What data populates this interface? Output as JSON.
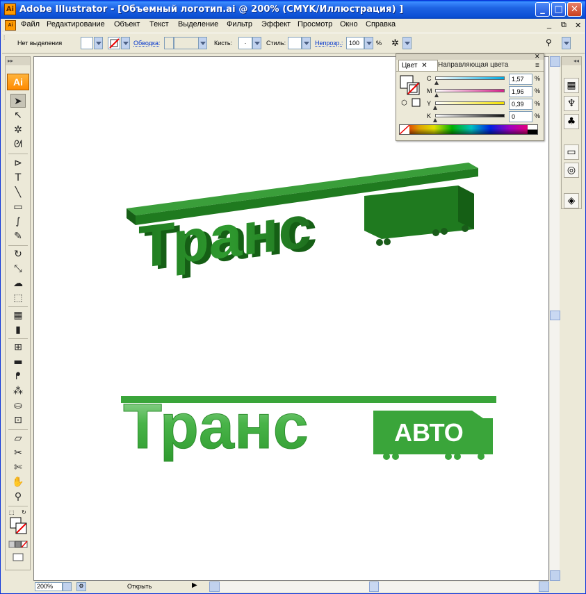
{
  "window": {
    "title": "Adobe Illustrator - [Объемный логотип.ai @ 200% (CMYK/Иллюстрация) ]",
    "app_icon_text": "Ai",
    "minimize": "_",
    "maximize": "□",
    "close": "✕"
  },
  "menu": {
    "items": [
      "Файл",
      "Редактирование",
      "Объект",
      "Текст",
      "Выделение",
      "Фильтр",
      "Эффект",
      "Просмотр",
      "Окно",
      "Справка"
    ],
    "doc_controls": [
      "_",
      "⧉",
      "✕"
    ]
  },
  "control_bar": {
    "selection_label": "Нет выделения",
    "stroke_label": "Обводка:",
    "brush_label": "Кисть:",
    "brush_value": "·",
    "style_label": "Стиль:",
    "opacity_label": "Непрозр.:",
    "opacity_value": "100",
    "opacity_unit": "%"
  },
  "toolbox": {
    "logo": "Ai",
    "tools": [
      {
        "name": "selection-tool",
        "glyph": "➤"
      },
      {
        "name": "direct-selection-tool",
        "glyph": "↖"
      },
      {
        "name": "magic-wand-tool",
        "glyph": "✲"
      },
      {
        "name": "lasso-tool",
        "glyph": "ᘛ"
      },
      {
        "name": "pen-tool",
        "glyph": "⊳"
      },
      {
        "name": "type-tool",
        "glyph": "T"
      },
      {
        "name": "line-tool",
        "glyph": "╲"
      },
      {
        "name": "rectangle-tool",
        "glyph": "▭"
      },
      {
        "name": "paintbrush-tool",
        "glyph": "∫"
      },
      {
        "name": "pencil-tool",
        "glyph": "✎"
      },
      {
        "name": "rotate-tool",
        "glyph": "↻"
      },
      {
        "name": "scale-tool",
        "glyph": "⤡"
      },
      {
        "name": "warp-tool",
        "glyph": "☁"
      },
      {
        "name": "free-transform-tool",
        "glyph": "⬚"
      },
      {
        "name": "symbol-sprayer-tool",
        "glyph": "▦"
      },
      {
        "name": "graph-tool",
        "glyph": "▮"
      },
      {
        "name": "mesh-tool",
        "glyph": "⊞"
      },
      {
        "name": "gradient-tool",
        "glyph": "▬"
      },
      {
        "name": "eyedropper-tool",
        "glyph": "ᖰ"
      },
      {
        "name": "blend-tool",
        "glyph": "⁂"
      },
      {
        "name": "live-paint-tool",
        "glyph": "⛀"
      },
      {
        "name": "live-paint-selection-tool",
        "glyph": "⊡"
      },
      {
        "name": "eraser-tool",
        "glyph": "▱"
      },
      {
        "name": "slice-tool",
        "glyph": "✂"
      },
      {
        "name": "scissors-tool",
        "glyph": "✄"
      },
      {
        "name": "hand-tool",
        "glyph": "✋"
      },
      {
        "name": "zoom-tool",
        "glyph": "⚲"
      }
    ]
  },
  "color_panel": {
    "tab_active": "Цвет",
    "tab_inactive": "Направляющая цвета",
    "channels": [
      {
        "label": "C",
        "value": "1,57",
        "color": "#00a9e0",
        "fraction": 0.0157
      },
      {
        "label": "M",
        "value": "1,96",
        "color": "#d6208a",
        "fraction": 0.0196
      },
      {
        "label": "Y",
        "value": "0,39",
        "color": "#f2e000",
        "fraction": 0.0039
      },
      {
        "label": "K",
        "value": "0",
        "color": "#111111",
        "fraction": 0
      }
    ],
    "percent": "%"
  },
  "canvas": {
    "logo3d": {
      "text": "Транс",
      "color": "#2e8b2e"
    },
    "logo2d": {
      "text": "Транс",
      "truck_text": "АВТО",
      "color": "#3aa53a"
    }
  },
  "status": {
    "zoom": "200%",
    "status_text": "Открыть"
  },
  "colors": {
    "title_bar": "#0b4fd4",
    "logo_green": "#2e8b2e",
    "logo_light_green": "#56bf56"
  }
}
